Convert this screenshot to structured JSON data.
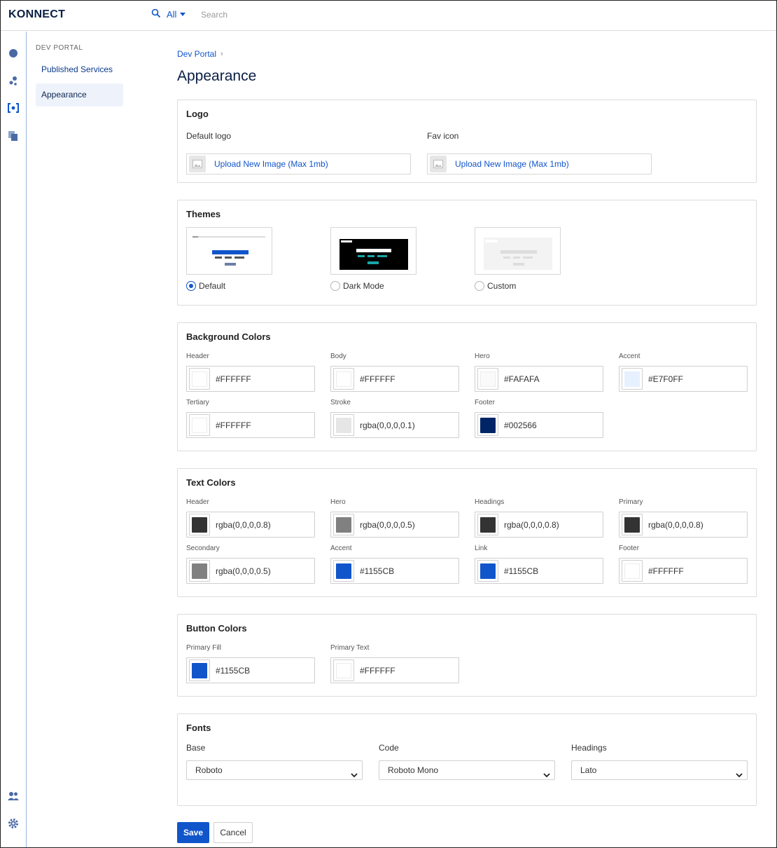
{
  "topbar": {
    "logo": "KONNECT",
    "filter": "All",
    "search_placeholder": "Search"
  },
  "rail": {
    "icons": [
      "dashboard-icon",
      "services-icon",
      "dev-portal-icon",
      "copy-icon",
      "people-icon",
      "gear-icon"
    ]
  },
  "sidebar": {
    "heading": "DEV PORTAL",
    "items": [
      {
        "label": "Published Services",
        "active": false
      },
      {
        "label": "Appearance",
        "active": true
      }
    ]
  },
  "breadcrumb": {
    "root": "Dev Portal",
    "separator": "›"
  },
  "page": {
    "title": "Appearance"
  },
  "logo_section": {
    "title": "Logo",
    "default_logo_label": "Default logo",
    "fav_icon_label": "Fav icon",
    "upload_text": "Upload New Image (Max 1mb)"
  },
  "themes": {
    "title": "Themes",
    "options": [
      {
        "label": "Default",
        "checked": true
      },
      {
        "label": "Dark Mode",
        "checked": false
      },
      {
        "label": "Custom",
        "checked": false
      }
    ]
  },
  "background_colors": {
    "title": "Background Colors",
    "fields": [
      {
        "label": "Header",
        "value": "#FFFFFF",
        "swatch": "#FFFFFF"
      },
      {
        "label": "Body",
        "value": "#FFFFFF",
        "swatch": "#FFFFFF"
      },
      {
        "label": "Hero",
        "value": "#FAFAFA",
        "swatch": "#FAFAFA"
      },
      {
        "label": "Accent",
        "value": "#E7F0FF",
        "swatch": "#E7F0FF"
      },
      {
        "label": "Tertiary",
        "value": "#FFFFFF",
        "swatch": "#FFFFFF"
      },
      {
        "label": "Stroke",
        "value": "rgba(0,0,0,0.1)",
        "swatch": "#E6E6E6"
      },
      {
        "label": "Footer",
        "value": "#002566",
        "swatch": "#002566"
      }
    ]
  },
  "text_colors": {
    "title": "Text Colors",
    "fields": [
      {
        "label": "Header",
        "value": "rgba(0,0,0,0.8)",
        "swatch": "#333333"
      },
      {
        "label": "Hero",
        "value": "rgba(0,0,0,0.5)",
        "swatch": "#808080"
      },
      {
        "label": "Headings",
        "value": "rgba(0,0,0,0.8)",
        "swatch": "#333333"
      },
      {
        "label": "Primary",
        "value": "rgba(0,0,0,0.8)",
        "swatch": "#333333"
      },
      {
        "label": "Secondary",
        "value": "rgba(0,0,0,0.5)",
        "swatch": "#808080"
      },
      {
        "label": "Accent",
        "value": "#1155CB",
        "swatch": "#1155CB"
      },
      {
        "label": "Link",
        "value": "#1155CB",
        "swatch": "#1155CB"
      },
      {
        "label": "Footer",
        "value": "#FFFFFF",
        "swatch": "#FFFFFF"
      }
    ]
  },
  "button_colors": {
    "title": "Button Colors",
    "fields": [
      {
        "label": "Primary Fill",
        "value": "#1155CB",
        "swatch": "#1155CB"
      },
      {
        "label": "Primary Text",
        "value": "#FFFFFF",
        "swatch": "#FFFFFF"
      }
    ]
  },
  "fonts": {
    "title": "Fonts",
    "fields": [
      {
        "label": "Base",
        "value": "Roboto"
      },
      {
        "label": "Code",
        "value": "Roboto Mono"
      },
      {
        "label": "Headings",
        "value": "Lato"
      }
    ]
  },
  "actions": {
    "save": "Save",
    "cancel": "Cancel"
  },
  "colors": {
    "accent": "#1155CB",
    "brand_dark": "#0B1F44",
    "theme_dark_bg": "#000000"
  }
}
